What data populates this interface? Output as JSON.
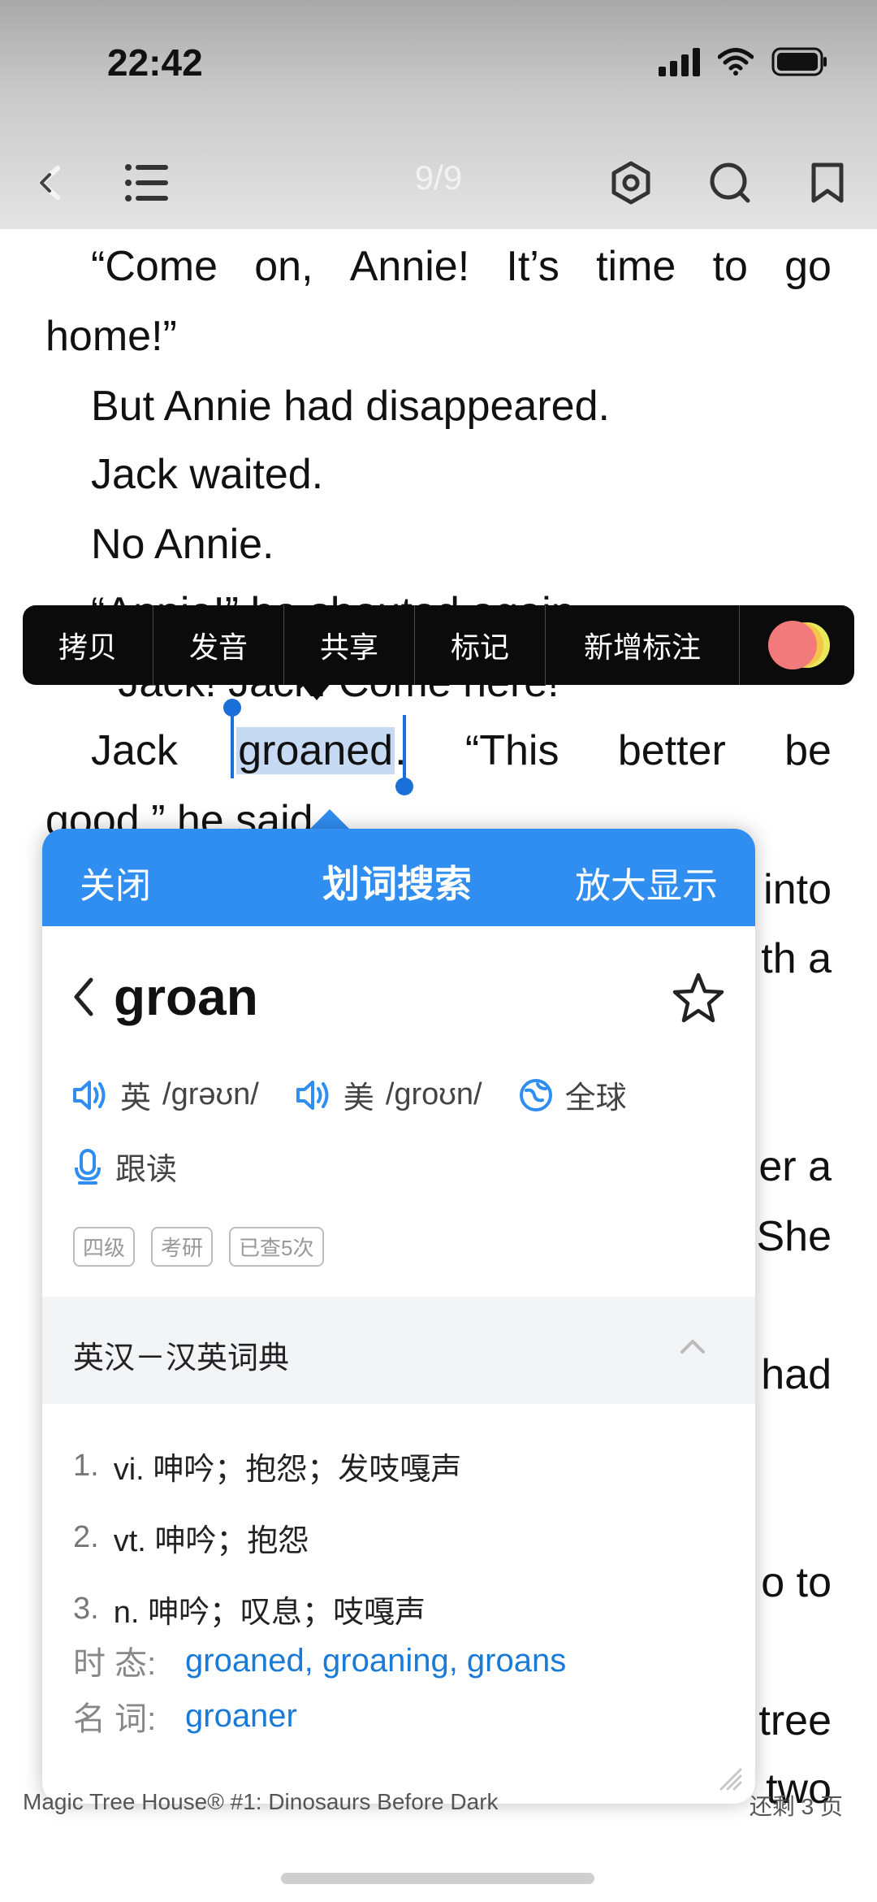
{
  "status": {
    "time": "22:42"
  },
  "toolbar": {
    "page_count": "9/9"
  },
  "book": {
    "lines": [
      [
        "“Come",
        "on,",
        "Annie!",
        "It’s",
        "time",
        "to",
        "go"
      ],
      "home!”",
      "But Annie had disappeared.",
      "Jack waited.",
      "No Annie.",
      "“Annie!” he shouted again.",
      "“Jack! Jack! Come here!”",
      [
        "Jack",
        "groaned",
        ".",
        "“This",
        "better",
        "be"
      ],
      "good,” he said.",
      "into",
      "th a",
      "er a",
      "She",
      "had",
      "o to",
      "tree",
      "two"
    ],
    "selected_word": "groaned"
  },
  "context_menu": {
    "items": [
      "拷贝",
      "发音",
      "共享",
      "标记",
      "新增标注"
    ],
    "colors": [
      "#f27a7a",
      "#f5c54a",
      "#e8e85a"
    ]
  },
  "dict": {
    "header": {
      "close": "关闭",
      "title": "划词搜索",
      "zoom": "放大显示"
    },
    "word": "groan",
    "uk_label": "英",
    "uk_ipa": "/ɡrəʊn/",
    "us_label": "美",
    "us_ipa": "/ɡroʊn/",
    "global": "全球",
    "follow": "跟读",
    "tags": [
      "四级",
      "考研",
      "已查5次"
    ],
    "dictionary_name": "英汉－汉英词典",
    "definitions": [
      {
        "num": "1.",
        "text": "vi. 呻吟；抱怨；发吱嘎声"
      },
      {
        "num": "2.",
        "text": "vt. 呻吟；抱怨"
      },
      {
        "num": "3.",
        "text": "n. 呻吟；叹息；吱嘎声"
      }
    ],
    "tense_label": "时 态:",
    "tense_value": "groaned, groaning, groans",
    "noun_label": "名 词:",
    "noun_value": "groaner",
    "accent": "#2f8ef0"
  },
  "footer": {
    "book_title": "Magic Tree House® #1: Dinosaurs Before Dark",
    "remaining": "还剩 3 页"
  }
}
